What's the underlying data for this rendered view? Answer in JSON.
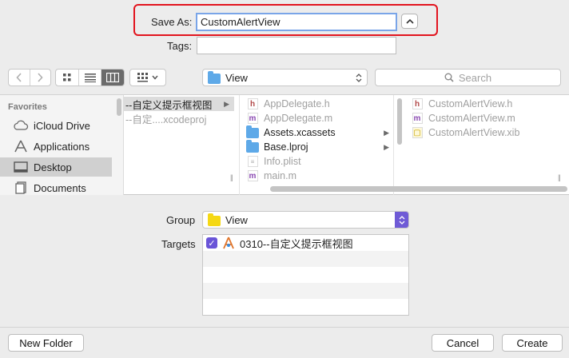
{
  "header": {
    "save_as_label": "Save As:",
    "save_as_value": "CustomAlertView",
    "tags_label": "Tags:",
    "tags_value": ""
  },
  "toolbar": {
    "location": "View",
    "search_placeholder": "Search"
  },
  "sidebar": {
    "heading": "Favorites",
    "items": [
      {
        "label": "iCloud Drive",
        "icon": "cloud-icon"
      },
      {
        "label": "Applications",
        "icon": "applications-icon"
      },
      {
        "label": "Desktop",
        "icon": "desktop-icon",
        "selected": true
      },
      {
        "label": "Documents",
        "icon": "documents-icon"
      }
    ]
  },
  "columns": {
    "col1": [
      {
        "label": "--自定义提示框视图"
      },
      {
        "label": "--自定....xcodeproj"
      }
    ],
    "col2": [
      {
        "label": "AppDelegate.h",
        "badge": "h"
      },
      {
        "label": "AppDelegate.m",
        "badge": "m"
      },
      {
        "label": "Assets.xcassets",
        "type": "folder"
      },
      {
        "label": "Base.lproj",
        "type": "folder"
      },
      {
        "label": "Info.plist",
        "type": "plist"
      },
      {
        "label": "main.m",
        "badge": "m"
      }
    ],
    "col3": [
      {
        "label": "CustomAlertView.h",
        "badge": "h"
      },
      {
        "label": "CustomAlertView.m",
        "badge": "m"
      },
      {
        "label": "CustomAlertView.xib",
        "type": "xib"
      }
    ]
  },
  "options": {
    "group_label": "Group",
    "group_value": "View",
    "targets_label": "Targets",
    "targets": [
      {
        "label": "0310--自定义提示框视图",
        "checked": true
      }
    ]
  },
  "footer": {
    "new_folder": "New Folder",
    "cancel": "Cancel",
    "create": "Create"
  },
  "colors": {
    "highlight": "#e2141e",
    "accent": "#6a55d8",
    "folder_blue": "#5ea9e8",
    "folder_yellow": "#f5d814"
  }
}
